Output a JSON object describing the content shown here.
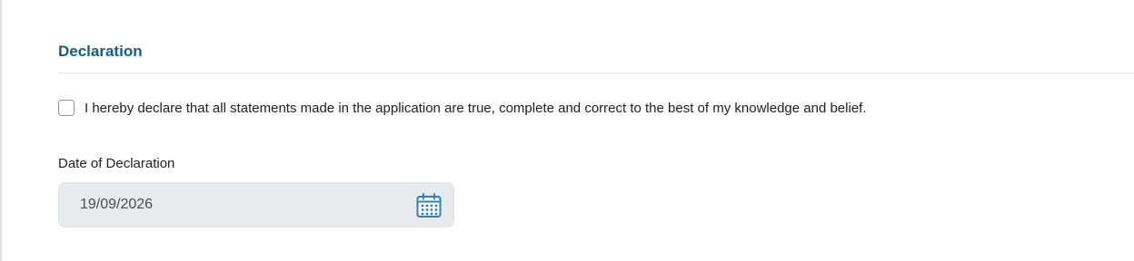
{
  "section": {
    "title": "Declaration"
  },
  "declaration": {
    "text": "I hereby declare that all statements made in the application are true, complete and correct to the best of my knowledge and belief.",
    "checked": false
  },
  "date_field": {
    "label": "Date of Declaration",
    "value": "19/09/2026",
    "icon": "calendar-icon"
  },
  "colors": {
    "title": "#14607e",
    "icon": "#2a7fc4",
    "field_bg": "#e8ebee"
  }
}
